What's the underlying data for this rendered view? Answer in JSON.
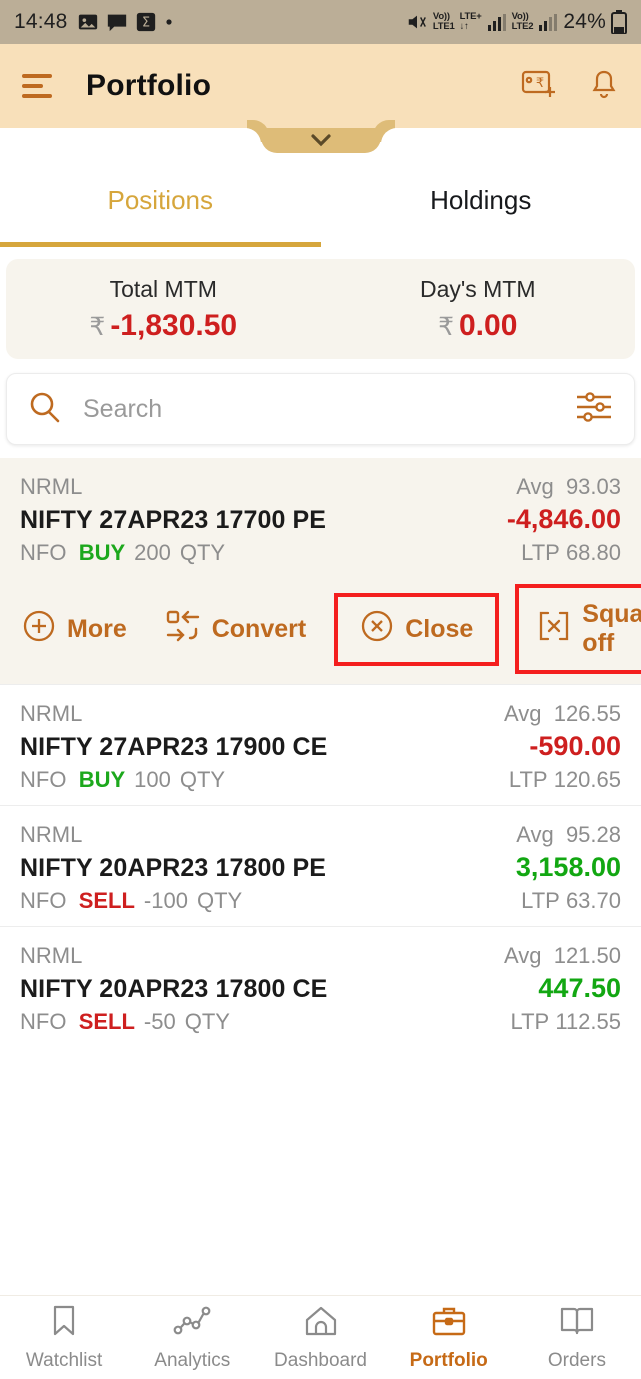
{
  "statusbar": {
    "time": "14:48",
    "icons": [
      "image-icon",
      "message-icon",
      "sigma-icon",
      "dot-icon"
    ],
    "mute_icon": "mute-icon",
    "sim1_top": "Vo))",
    "sim1_bottom": "LTE1",
    "sim1_type": "LTE+",
    "sim1_arrows": "↓↑",
    "sim2_top": "Vo))",
    "sim2_bottom": "LTE2",
    "battery": "24%"
  },
  "header": {
    "menu_icon": "hamburger-menu-icon",
    "title": "Portfolio",
    "add_funds_icon": "add-funds-icon",
    "notification_icon": "bell-icon",
    "pull_tab_icon": "chevron-down-icon"
  },
  "tabs": [
    {
      "label": "Positions",
      "active": true
    },
    {
      "label": "Holdings",
      "active": false
    }
  ],
  "summary": {
    "total": {
      "label": "Total MTM",
      "currency": "₹",
      "value": "-1,830.50",
      "color": "#CE1F1F"
    },
    "day": {
      "label": "Day's MTM",
      "currency": "₹",
      "value": "0.00",
      "color": "#CE1F1F"
    }
  },
  "search": {
    "icon": "search-icon",
    "placeholder": "Search",
    "value": "",
    "filter_icon": "filter-sliders-icon"
  },
  "positions": [
    {
      "product": "NRML",
      "name": "NIFTY 27APR23 17700 PE",
      "exchange": "NFO",
      "side": "BUY",
      "qty": "200",
      "qty_unit": "QTY",
      "avg_label": "Avg",
      "avg": "93.03",
      "pnl": "-4,846.00",
      "pnl_sign": "negative",
      "ltp_label": "LTP",
      "ltp": "68.80",
      "expanded": true
    },
    {
      "product": "NRML",
      "name": "NIFTY 27APR23 17900 CE",
      "exchange": "NFO",
      "side": "BUY",
      "qty": "100",
      "qty_unit": "QTY",
      "avg_label": "Avg",
      "avg": "126.55",
      "pnl": "-590.00",
      "pnl_sign": "negative",
      "ltp_label": "LTP",
      "ltp": "120.65",
      "expanded": false
    },
    {
      "product": "NRML",
      "name": "NIFTY 20APR23 17800 PE",
      "exchange": "NFO",
      "side": "SELL",
      "qty": "-100",
      "qty_unit": "QTY",
      "avg_label": "Avg",
      "avg": "95.28",
      "pnl": "3,158.00",
      "pnl_sign": "positive",
      "ltp_label": "LTP",
      "ltp": "63.70",
      "expanded": false
    },
    {
      "product": "NRML",
      "name": "NIFTY 20APR23 17800 CE",
      "exchange": "NFO",
      "side": "SELL",
      "qty": "-50",
      "qty_unit": "QTY",
      "avg_label": "Avg",
      "avg": "121.50",
      "pnl": "447.50",
      "pnl_sign": "positive",
      "ltp_label": "LTP",
      "ltp": "112.55",
      "expanded": false
    }
  ],
  "actions": [
    {
      "label": "More",
      "icon": "plus-circle-icon",
      "highlighted": false
    },
    {
      "label": "Convert",
      "icon": "convert-icon",
      "highlighted": false
    },
    {
      "label": "Close",
      "icon": "close-circle-icon",
      "highlighted": true
    },
    {
      "label": "Square off",
      "icon": "square-off-icon",
      "highlighted": true
    }
  ],
  "highlight_color": "#F41E1E",
  "accent_color": "#BE6A20",
  "bottom_nav": [
    {
      "label": "Watchlist",
      "icon": "bookmark-icon",
      "active": false
    },
    {
      "label": "Analytics",
      "icon": "line-chart-icon",
      "active": false
    },
    {
      "label": "Dashboard",
      "icon": "home-icon",
      "active": false
    },
    {
      "label": "Portfolio",
      "icon": "briefcase-icon",
      "active": true
    },
    {
      "label": "Orders",
      "icon": "book-icon",
      "active": false
    }
  ]
}
